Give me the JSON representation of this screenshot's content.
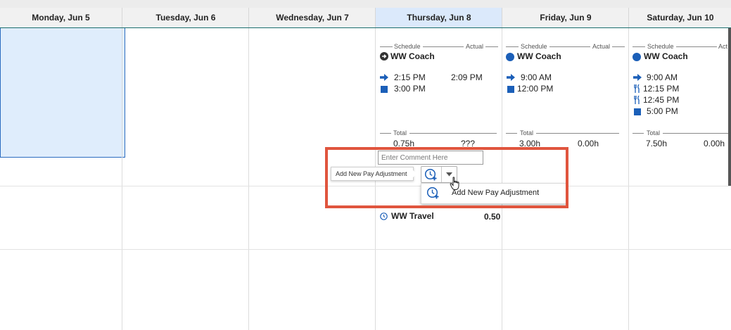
{
  "days": [
    {
      "label": "Monday, Jun 5"
    },
    {
      "label": "Tuesday, Jun 6"
    },
    {
      "label": "Wednesday, Jun 7"
    },
    {
      "label": "Thursday, Jun 8"
    },
    {
      "label": "Friday, Jun 9"
    },
    {
      "label": "Saturday, Jun 10"
    }
  ],
  "thursday": {
    "schedule_label": "Schedule",
    "actual_label": "Actual",
    "name": "WW Coach",
    "in_time": "2:15 PM",
    "in_actual": "2:09 PM",
    "out_time": "3:00 PM",
    "total_label": "Total",
    "total_schedule": "0.75h",
    "total_actual": "???",
    "comment_placeholder": "Enter Comment Here",
    "travel_name": "WW Travel",
    "travel_value": "0.50"
  },
  "friday": {
    "schedule_label": "Schedule",
    "actual_label": "Actual",
    "name": "WW Coach",
    "in_time": "9:00 AM",
    "out_time": "12:00 PM",
    "total_label": "Total",
    "total_schedule": "3.00h",
    "total_actual": "0.00h"
  },
  "saturday": {
    "schedule_label": "Schedule",
    "actual_label": "Act",
    "name": "WW Coach",
    "in_time": "9:00 AM",
    "meal_out": "12:15 PM",
    "meal_in": "12:45 PM",
    "out_time": "5:00 PM",
    "total_label": "Total",
    "total_schedule": "7.50h",
    "total_actual": "0.00h"
  },
  "pay_adjust": {
    "tooltip": "Add New Pay Adjustment",
    "menu_item": "Add New Pay Adjustment"
  },
  "colors": {
    "accent": "#1b5fb8",
    "selected_bg": "#dfedfc",
    "highlight": "#e0553e"
  }
}
